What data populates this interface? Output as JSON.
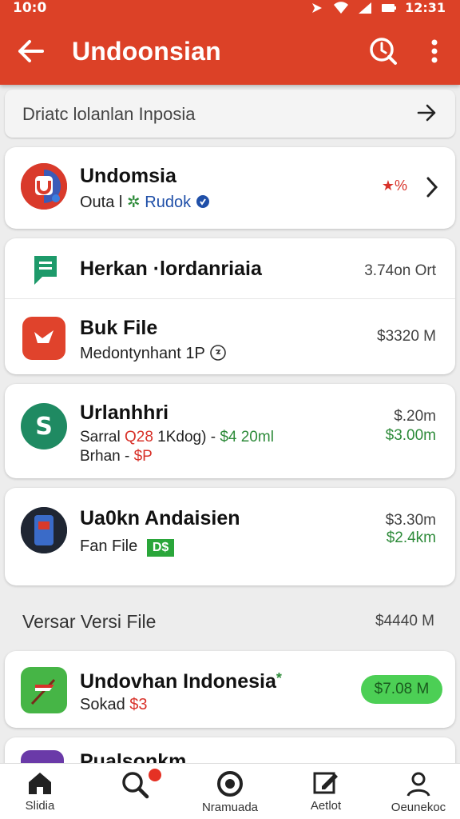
{
  "status_bar": {
    "time_left": "10:0",
    "time_right": "12:31"
  },
  "header": {
    "title": "Undoonsian"
  },
  "breadcrumb": {
    "text": "Driatc lolanlan Inposia"
  },
  "item1": {
    "name": "Undomsia",
    "sub_a": "Outa l",
    "sub_b": "Rudok",
    "rating": "%"
  },
  "item2": {
    "name": "Herkan ·lordanriaia",
    "value": "3.74on Ort"
  },
  "item3": {
    "name": "Buk File",
    "sub": "Medontynhant 1P",
    "value": "$3320 M"
  },
  "item4": {
    "name": "Urlanhhri",
    "sub_a": "Sarral",
    "sub_red": "Q28",
    "sub_b": "1Kdog) -",
    "sub_green": "$4 20ml",
    "sub_line2": "Brhan -",
    "sub_line2_red": "$P",
    "value1": "$.20m",
    "value2": "$3.00m"
  },
  "item5": {
    "name": "Ua0kn Andaisien",
    "sub": "Fan File",
    "badge": "D$",
    "value1": "$3.30m",
    "value2": "$2.4km"
  },
  "section": {
    "title": "Versar Versi File",
    "value": "$4440 M"
  },
  "item6": {
    "name": "Undovhan Indonesia",
    "sub": "Sokad",
    "sub_red": "$3",
    "price": "$7.08 M"
  },
  "item7": {
    "name": "Pualsonkm"
  },
  "nav": {
    "items": [
      {
        "label": "Slidia"
      },
      {
        "label": ""
      },
      {
        "label": "Nramuada"
      },
      {
        "label": "Aetlot"
      },
      {
        "label": "Oeunekoc"
      }
    ]
  },
  "colors": {
    "primary": "#dc4127",
    "green_pill": "#4ccf55"
  }
}
